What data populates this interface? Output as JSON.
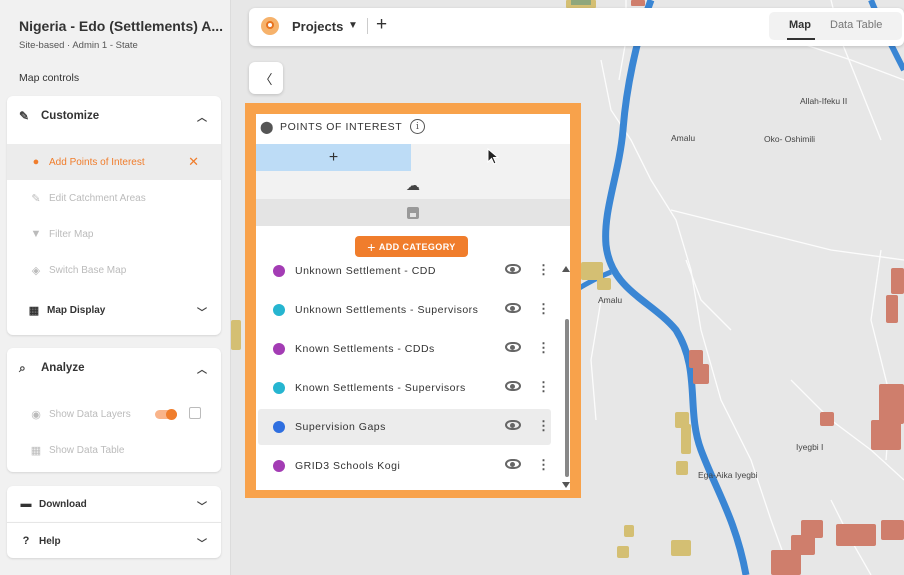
{
  "project": {
    "title": "Nigeria - Edo (Settlements) A...",
    "subtitle": "Site-based · Admin 1 - State"
  },
  "sidebar": {
    "map_controls_label": "Map controls",
    "customize": {
      "header": "Customize",
      "items": [
        {
          "label": "Add Points of Interest",
          "icon": "pin-icon",
          "active": true
        },
        {
          "label": "Edit Catchment Areas",
          "icon": "pencil-icon"
        },
        {
          "label": "Filter Map",
          "icon": "filter-icon"
        },
        {
          "label": "Switch Base Map",
          "icon": "layers-icon"
        }
      ],
      "map_display": "Map Display"
    },
    "analyze": {
      "header": "Analyze",
      "items": [
        {
          "label": "Show Data Layers",
          "icon": "eye-icon"
        },
        {
          "label": "Show Data Table",
          "icon": "table-icon"
        }
      ]
    },
    "download": "Download",
    "help": "Help"
  },
  "topbar": {
    "projects_label": "Projects",
    "tabs": [
      {
        "label": "Map",
        "active": true
      },
      {
        "label": "Data Table",
        "active": false
      }
    ]
  },
  "map": {
    "places": [
      "Allah-Ifeku II",
      "Amalu",
      "Oko- Oshimili",
      "Amalu",
      "Iyegbi I",
      "Ega-Aika Iyegbi"
    ],
    "river_color": "#3a86d4",
    "settlement_colors": {
      "supervisor": "#d4bf73",
      "cdd": "#cf7e6c"
    }
  },
  "poi": {
    "title": "POINTS OF INTEREST",
    "add_category": "ADD CATEGORY",
    "categories": [
      {
        "label": "Unknown Settlement - CDD",
        "color": "#a33cb4"
      },
      {
        "label": "Unknown Settlements - Supervisors",
        "color": "#26b5d0"
      },
      {
        "label": "Known Settlements - CDDs",
        "color": "#a33cb4"
      },
      {
        "label": "Known Settlements - Supervisors",
        "color": "#26b5d0"
      },
      {
        "label": "Supervision Gaps",
        "color": "#2f6fe0",
        "selected": true
      },
      {
        "label": "GRID3 Schools Kogi",
        "color": "#a33cb4"
      }
    ]
  }
}
